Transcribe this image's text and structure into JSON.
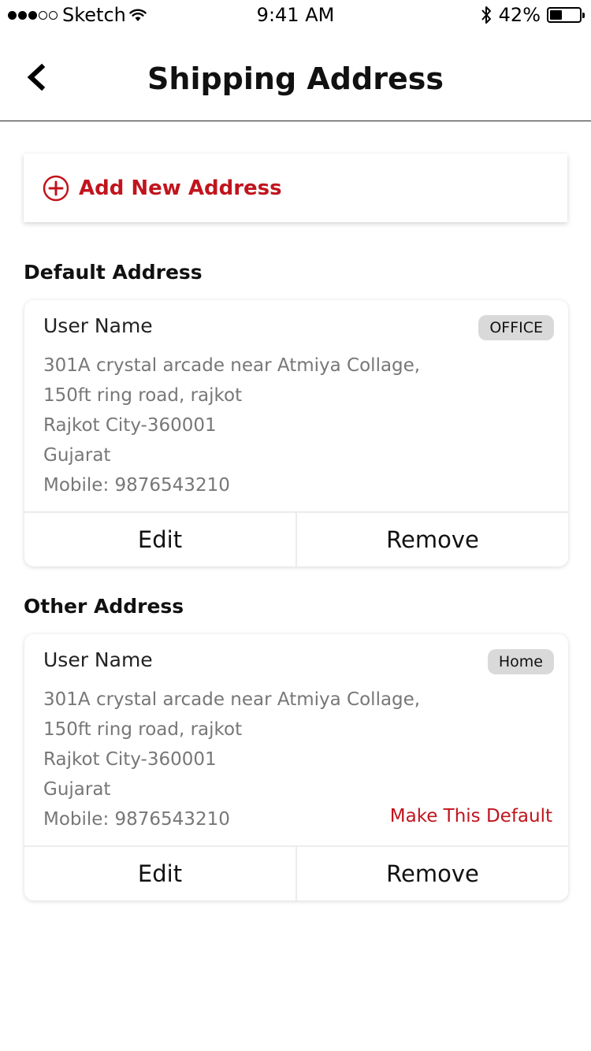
{
  "status_bar": {
    "carrier": "Sketch",
    "time": "9:41 AM",
    "battery_percent": "42%",
    "battery_level": 0.42,
    "icons": [
      "signal-dots",
      "wifi-icon",
      "bluetooth-icon",
      "battery-icon"
    ]
  },
  "nav": {
    "title": "Shipping Address",
    "back_icon": "chevron-left-icon"
  },
  "add_address": {
    "label": "Add New Address",
    "icon": "plus-circle-icon",
    "color": "#c1141d"
  },
  "sections": {
    "default_title": "Default Address",
    "other_title": "Other Address"
  },
  "default_address": {
    "name": "User Name",
    "tag": "OFFICE",
    "lines": [
      "301A crystal arcade near Atmiya Collage,",
      "150ft ring road, rajkot",
      "Rajkot City-360001",
      "Gujarat",
      "Mobile: 9876543210"
    ],
    "edit_label": "Edit",
    "remove_label": "Remove"
  },
  "other_address": {
    "name": "User Name",
    "tag": "Home",
    "lines": [
      "301A crystal arcade near Atmiya Collage,",
      "150ft ring road, rajkot",
      "Rajkot City-360001",
      "Gujarat",
      "Mobile: 9876543210"
    ],
    "make_default_label": "Make This Default",
    "edit_label": "Edit",
    "remove_label": "Remove"
  }
}
